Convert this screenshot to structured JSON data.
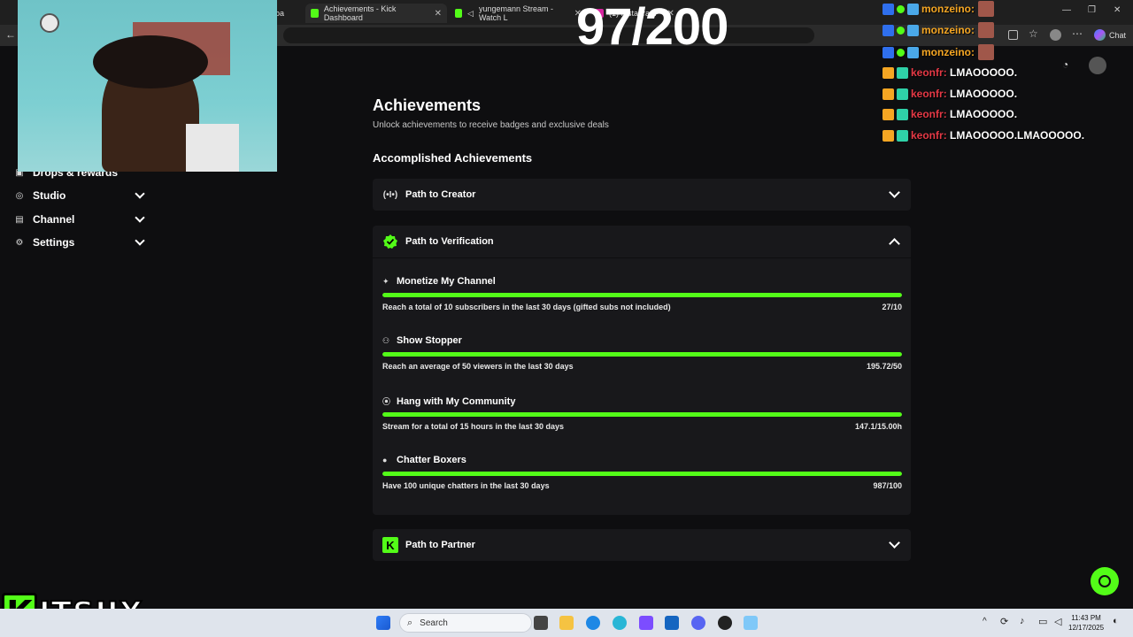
{
  "browser": {
    "tabs": [
      {
        "label": "boa",
        "active": false
      },
      {
        "label": "Achievements - Kick Dashboard",
        "active": true
      },
      {
        "label": "yungemann Stream - Watch L",
        "active": false
      },
      {
        "label": "(1) Instagram",
        "active": false
      }
    ],
    "chat_button_label": "Chat"
  },
  "sidebar": {
    "items": [
      {
        "label": "Drops & rewards",
        "icon": "gift-icon"
      },
      {
        "label": "Studio",
        "icon": "studio-icon"
      },
      {
        "label": "Channel",
        "icon": "channel-icon"
      },
      {
        "label": "Settings",
        "icon": "gear-icon"
      }
    ]
  },
  "main": {
    "title": "Achievements",
    "subtitle": "Unlock achievements to receive badges and exclusive deals",
    "section_title": "Accomplished Achievements",
    "groups": [
      {
        "title": "Path to Creator",
        "icon": "broadcast-icon",
        "expanded": false
      },
      {
        "title": "Path to Verification",
        "icon": "verified-check-icon",
        "expanded": true
      },
      {
        "title": "Path to Partner",
        "icon": "kick-logo-icon",
        "expanded": false
      }
    ],
    "achievements": [
      {
        "title": "Monetize My Channel",
        "icon": "sparkle-icon",
        "description": "Reach a total of 10 subscribers in the last 30 days (gifted subs not included)",
        "value": "27/10",
        "progress": 1.0
      },
      {
        "title": "Show Stopper",
        "icon": "people-icon",
        "description": "Reach an average of 50 viewers in the last 30 days",
        "value": "195.72/50",
        "progress": 1.0
      },
      {
        "title": "Hang with My Community",
        "icon": "broadcast-icon",
        "description": "Stream for a total of 15 hours in the last 30 days",
        "value": "147.1/15.00h",
        "progress": 1.0
      },
      {
        "title": "Chatter Boxers",
        "icon": "chat-bubble-icon",
        "description": "Have 100 unique chatters in the last 30 days",
        "value": "987/100",
        "progress": 1.0
      }
    ]
  },
  "overlay": {
    "counter": "97/200",
    "streamer_logo_text": "ITSJJX",
    "chat": [
      {
        "user": "monzeino",
        "message": "",
        "color": "#f5a623"
      },
      {
        "user": "monzeino",
        "message": "",
        "color": "#f5a623"
      },
      {
        "user": "monzeino",
        "message": "",
        "color": "#f5a623"
      },
      {
        "user": "keonfr",
        "message": "LMAOOOOO.",
        "color": "#e63946"
      },
      {
        "user": "keonfr",
        "message": "LMAOOOOO.",
        "color": "#e63946"
      },
      {
        "user": "keonfr",
        "message": "LMAOOOOO.",
        "color": "#e63946"
      },
      {
        "user": "keonfr",
        "message": "LMAOOOOO.LMAOOOOO.",
        "color": "#e63946"
      }
    ]
  },
  "taskbar": {
    "search_placeholder": "Search",
    "time": "11:43 PM",
    "date": "12/17/2025"
  },
  "colors": {
    "accent": "#53fc18",
    "background": "#0e0e10",
    "card": "#18181b"
  }
}
